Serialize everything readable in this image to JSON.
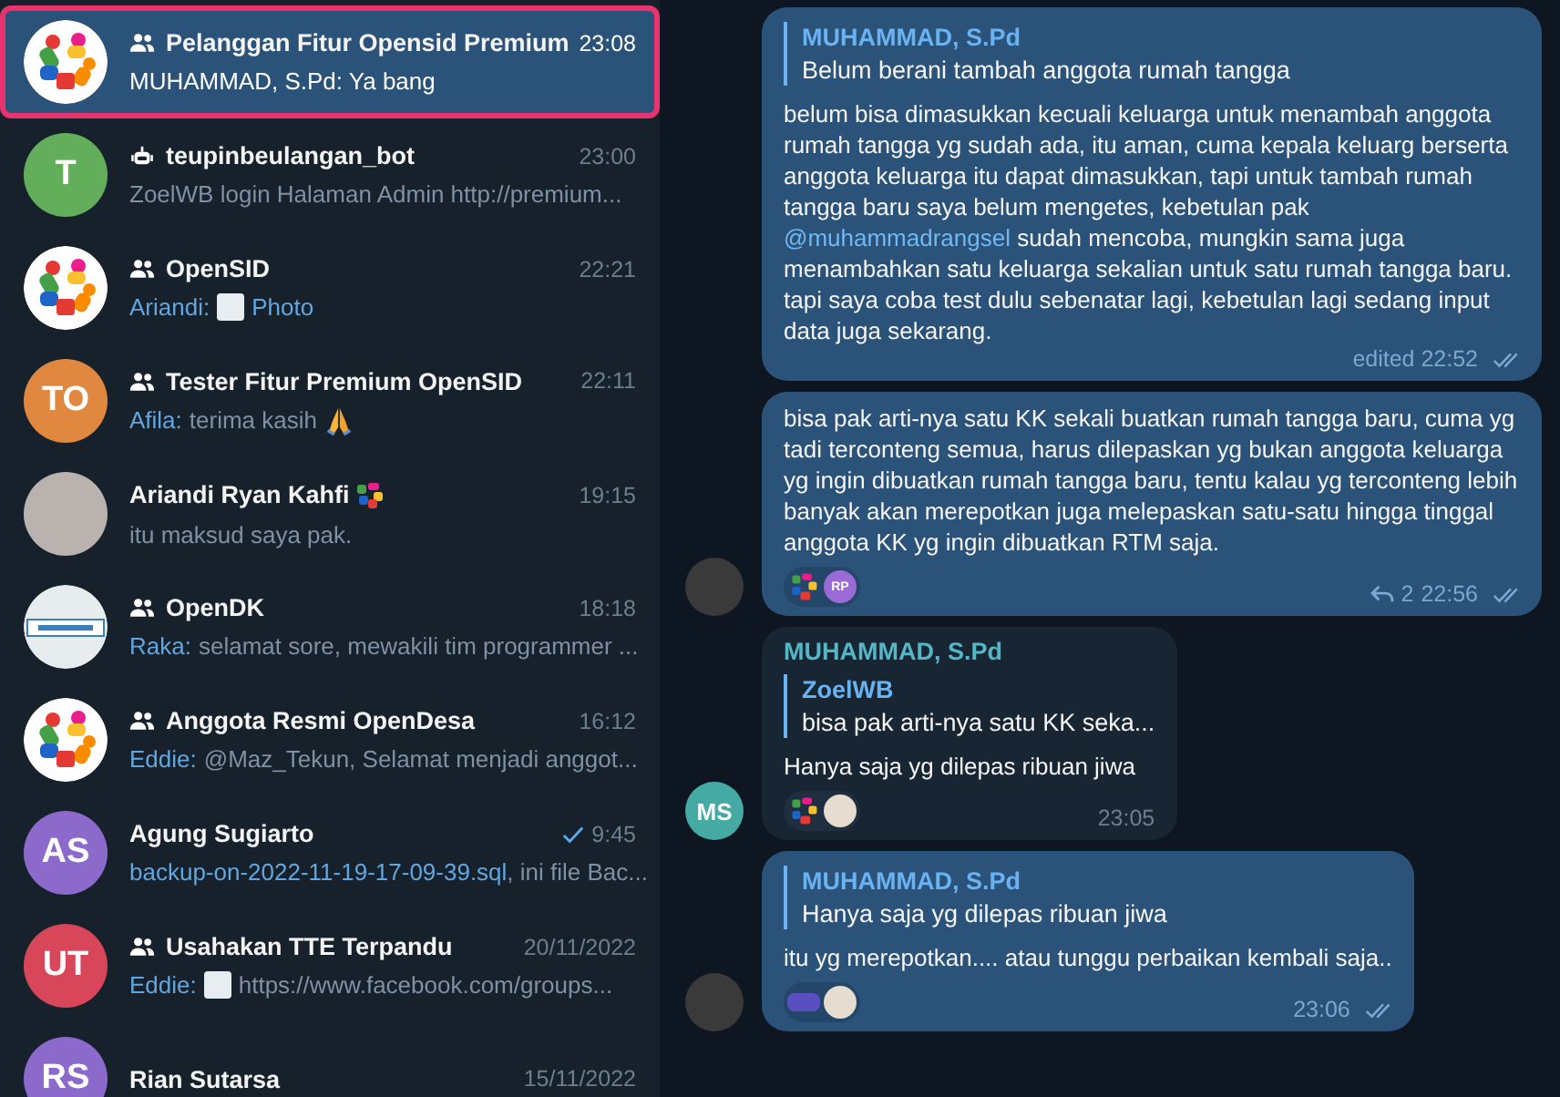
{
  "chats": [
    {
      "selected": true,
      "avatar": {
        "kind": "logo"
      },
      "kind": "group",
      "name": "Pelanggan Fitur Opensid Premium",
      "emoji_status": false,
      "time": "23:08",
      "sent": false,
      "preview": [
        {
          "kind": "text",
          "text": "MUHAMMAD, S.Pd: Ya bang"
        }
      ]
    },
    {
      "selected": false,
      "avatar": {
        "kind": "initials",
        "text": "T",
        "color": "#62ae5a"
      },
      "kind": "bot",
      "name": "teupinbeulangan_bot",
      "emoji_status": false,
      "time": "23:00",
      "sent": false,
      "preview": [
        {
          "kind": "text",
          "text": "ZoelWB login Halaman Admin http://premium..."
        }
      ]
    },
    {
      "selected": false,
      "avatar": {
        "kind": "logo"
      },
      "kind": "group",
      "name": "OpenSID",
      "emoji_status": false,
      "time": "22:21",
      "sent": false,
      "preview": [
        {
          "kind": "sender",
          "text": "Ariandi:"
        },
        {
          "kind": "thumb"
        },
        {
          "kind": "accent",
          "text": "Photo"
        }
      ]
    },
    {
      "selected": false,
      "avatar": {
        "kind": "initials",
        "text": "TO",
        "color": "#e0883f"
      },
      "kind": "group",
      "name": "Tester Fitur Premium OpenSID",
      "emoji_status": false,
      "time": "22:11",
      "sent": false,
      "preview": [
        {
          "kind": "sender",
          "text": "Afila:"
        },
        {
          "kind": "text",
          "text": "terima kasih"
        },
        {
          "kind": "pray"
        }
      ]
    },
    {
      "selected": false,
      "avatar": {
        "kind": "photo"
      },
      "kind": "person",
      "name": "Ariandi Ryan Kahfi",
      "emoji_status": true,
      "time": "19:15",
      "sent": false,
      "preview": [
        {
          "kind": "text",
          "text": "itu maksud saya pak."
        }
      ]
    },
    {
      "selected": false,
      "avatar": {
        "kind": "emblem"
      },
      "kind": "group",
      "name": "OpenDK",
      "emoji_status": false,
      "time": "18:18",
      "sent": false,
      "preview": [
        {
          "kind": "sender",
          "text": "Raka:"
        },
        {
          "kind": "text",
          "text": "selamat sore, mewakili tim programmer ..."
        }
      ]
    },
    {
      "selected": false,
      "avatar": {
        "kind": "logo"
      },
      "kind": "group",
      "name": "Anggota Resmi OpenDesa",
      "emoji_status": false,
      "time": "16:12",
      "sent": false,
      "preview": [
        {
          "kind": "sender",
          "text": "Eddie:"
        },
        {
          "kind": "text",
          "text": "@Maz_Tekun, Selamat menjadi anggot..."
        }
      ]
    },
    {
      "selected": false,
      "avatar": {
        "kind": "initials",
        "text": "AS",
        "color": "#8b6acb"
      },
      "kind": "person",
      "name": "Agung Sugiarto",
      "emoji_status": false,
      "time": "9:45",
      "sent": true,
      "preview": [
        {
          "kind": "accent",
          "text": "backup-on-2022-11-19-17-09-39.sql"
        },
        {
          "kind": "text",
          "text": ", ini file Bac..."
        }
      ]
    },
    {
      "selected": false,
      "avatar": {
        "kind": "initials",
        "text": "UT",
        "color": "#d8465a"
      },
      "kind": "group",
      "name": "Usahakan TTE Terpandu",
      "emoji_status": false,
      "time": "20/11/2022",
      "sent": false,
      "preview": [
        {
          "kind": "sender",
          "text": "Eddie:"
        },
        {
          "kind": "thumb"
        },
        {
          "kind": "text",
          "text": "https://www.facebook.com/groups..."
        }
      ]
    },
    {
      "selected": false,
      "avatar": {
        "kind": "initials",
        "text": "RS",
        "color": "#8b6acb"
      },
      "kind": "person",
      "name": "Rian Sutarsa",
      "emoji_status": false,
      "time": "15/11/2022",
      "sent": false
    }
  ],
  "messages": [
    {
      "outgoing": true,
      "avatar": {
        "kind": "none"
      },
      "reply": {
        "author": "MUHAMMAD, S.Pd",
        "text": "Belum berani tambah anggota rumah tangga"
      },
      "body": [
        {
          "kind": "text",
          "text": "belum bisa dimasukkan kecuali keluarga untuk menambah anggota rumah tangga yg sudah ada, itu aman, cuma kepala keluarg berserta anggota keluarga itu dapat dimasukkan, tapi untuk tambah rumah tangga baru saya belum mengetes, kebetulan pak "
        },
        {
          "kind": "mention",
          "text": "@muhammadrangsel"
        },
        {
          "kind": "text",
          "text": " sudah mencoba, mungkin sama juga menambahkan satu keluarga sekalian untuk satu rumah tangga baru. tapi saya coba test dulu sebenatar lagi, kebetulan lagi sedang input data juga sekarang."
        }
      ],
      "time": "edited 22:52",
      "read": true
    },
    {
      "outgoing": true,
      "avatar": {
        "kind": "photo"
      },
      "body": [
        {
          "kind": "text",
          "text": "bisa pak arti-nya satu KK sekali buatkan rumah tangga baru, cuma yg tadi terconteng semua, harus dilepaskan yg bukan anggota keluarga yg ingin dibuatkan rumah tangga baru, tentu kalau yg terconteng lebih banyak akan merepotkan juga melepaskan satu-satu hingga tinggal anggota KK yg ingin dibuatkan RTM saja."
        }
      ],
      "reactions": [
        {
          "kind": "logo"
        },
        {
          "kind": "initials",
          "text": "RP",
          "color": "#9a6bd6"
        }
      ],
      "replies": "2",
      "time": "22:56",
      "read": true
    },
    {
      "outgoing": false,
      "avatar": {
        "kind": "initials",
        "text": "MS",
        "color": "#45a9a4"
      },
      "author": "MUHAMMAD, S.Pd",
      "reply": {
        "author": "ZoelWB",
        "text": "bisa pak arti-nya satu KK seka..."
      },
      "body": [
        {
          "kind": "text",
          "text": "Hanya saja yg dilepas ribuan jiwa"
        }
      ],
      "reactions": [
        {
          "kind": "logo"
        },
        {
          "kind": "photo"
        }
      ],
      "time": "23:05"
    },
    {
      "outgoing": true,
      "avatar": {
        "kind": "photo"
      },
      "reply": {
        "author": "MUHAMMAD, S.Pd",
        "text": "Hanya saja yg dilepas ribuan jiwa"
      },
      "body": [
        {
          "kind": "text",
          "text": "itu yg merepotkan.... atau tunggu perbaikan kembali saja.."
        }
      ],
      "reactions": [
        {
          "kind": "banner"
        },
        {
          "kind": "photo"
        }
      ],
      "time": "23:06",
      "read": true
    }
  ]
}
